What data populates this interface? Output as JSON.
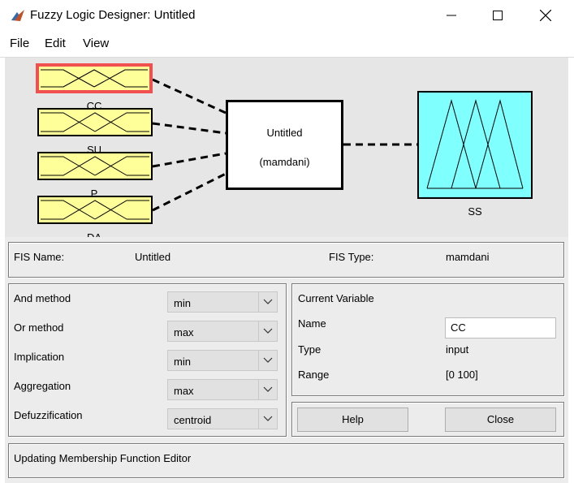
{
  "window": {
    "title": "Fuzzy Logic Designer: Untitled"
  },
  "menu": [
    "File",
    "Edit",
    "View"
  ],
  "inputs": [
    {
      "name": "CC",
      "selected": true
    },
    {
      "name": "SU",
      "selected": false
    },
    {
      "name": "P",
      "selected": false
    },
    {
      "name": "DA",
      "selected": false
    }
  ],
  "fis_block": {
    "name": "Untitled",
    "type": "(mamdani)"
  },
  "output": {
    "name": "SS"
  },
  "info": {
    "fis_name_label": "FIS Name:",
    "fis_name": "Untitled",
    "fis_type_label": "FIS Type:",
    "fis_type": "mamdani"
  },
  "methods": [
    {
      "label": "And method",
      "value": "min"
    },
    {
      "label": "Or method",
      "value": "max"
    },
    {
      "label": "Implication",
      "value": "min"
    },
    {
      "label": "Aggregation",
      "value": "max"
    },
    {
      "label": "Defuzzification",
      "value": "centroid"
    }
  ],
  "current_variable": {
    "heading": "Current Variable",
    "name_label": "Name",
    "name_value": "CC",
    "type_label": "Type",
    "type_value": "input",
    "range_label": "Range",
    "range_value": "[0 100]"
  },
  "buttons": {
    "help": "Help",
    "close": "Close"
  },
  "status": "Updating Membership Function Editor",
  "colors": {
    "input_fill": "#ffff99",
    "output_fill": "#80ffff",
    "selected_border": "#f05050",
    "panel_bg": "#ececec",
    "diagram_bg": "#e6e6e6"
  }
}
